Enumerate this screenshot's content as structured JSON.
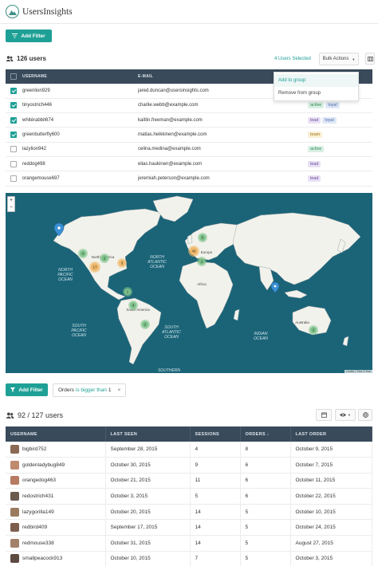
{
  "app": {
    "brand": "UsersInsights"
  },
  "toolbar1": {
    "add_filter": "Add Filter"
  },
  "users_header": {
    "count": "126 users",
    "selected": "4 Users Selected",
    "bulk_actions": "Bulk Actions"
  },
  "dropdown": {
    "items": [
      "Add to group",
      "Remove from group"
    ]
  },
  "table1": {
    "columns": [
      "USERNAME",
      "E-MAIL"
    ],
    "rows": [
      {
        "checked": true,
        "username": "greenlion929",
        "email": "jared.duncan@usersinsights.com",
        "tags": []
      },
      {
        "checked": true,
        "username": "tinyostrich446",
        "email": "charlie.webb@example.com",
        "tags": [
          "active",
          "loyal"
        ]
      },
      {
        "checked": true,
        "username": "whitérabbit674",
        "email": "kaitlin.freeman@example.com",
        "tags": [
          "lead",
          "loyal"
        ]
      },
      {
        "checked": true,
        "username": "greenbutterfly600",
        "email": "matias.heikkinen@example.com",
        "tags": [
          "team"
        ]
      },
      {
        "checked": false,
        "username": "lazylion942",
        "email": "celina.medina@example.com",
        "tags": [
          "active"
        ]
      },
      {
        "checked": false,
        "username": "reddog498",
        "email": "elias.haukinen@example.com",
        "tags": [
          "lead"
        ]
      },
      {
        "checked": false,
        "username": "orangemouse697",
        "email": "jeremiah.peterson@example.com",
        "tags": [
          "lead"
        ]
      }
    ]
  },
  "map": {
    "labels": {
      "north_america": "North America",
      "europe": "Europe",
      "africa": "Africa",
      "south_america": "South America",
      "australia": "Australia",
      "north_pacific": [
        "NORTH",
        "PACIFIC",
        "OCEAN"
      ],
      "north_atlantic": [
        "NORTH",
        "ATLANTIC",
        "OCEAN"
      ],
      "south_pacific": [
        "SOUTH",
        "PACIFIC",
        "OCEAN"
      ],
      "south_atlantic": [
        "SOUTH",
        "ATLANTIC",
        "OCEAN"
      ],
      "indian": [
        "INDIAN",
        "OCEAN"
      ],
      "southern": "SOUTHERN"
    },
    "clusters": [
      "4",
      "2",
      "17",
      "3",
      "6",
      "40",
      "2",
      "2",
      "4",
      "2",
      "2"
    ],
    "zoom_in": "+",
    "zoom_out": "−",
    "credit": "Leaflet | Tiles © Esri"
  },
  "filter2": {
    "add_filter": "Add Filter",
    "chip_field": "Orders",
    "chip_operator": "is bigger than",
    "chip_value": "1",
    "chip_remove": "×"
  },
  "users2": {
    "count": "92 / 127 users"
  },
  "table2": {
    "columns": [
      "USERNAME",
      "LAST SEEN",
      "SESSIONS",
      "ORDERS ↓",
      "LAST ORDER"
    ],
    "rows": [
      {
        "username": "bigbird752",
        "last_seen": "September 28, 2015",
        "sessions": "4",
        "orders": "8",
        "last_order": "October 9, 2015",
        "avatar": "#8a6a55"
      },
      {
        "username": "goldenladybug849",
        "last_seen": "October 30, 2015",
        "sessions": "9",
        "orders": "6",
        "last_order": "October 7, 2015",
        "avatar": "#c08a6e"
      },
      {
        "username": "orangedog463",
        "last_seen": "October 21, 2015",
        "sessions": "11",
        "orders": "6",
        "last_order": "October 11, 2015",
        "avatar": "#b77a63"
      },
      {
        "username": "redostrich431",
        "last_seen": "October 3, 2015",
        "sessions": "5",
        "orders": "6",
        "last_order": "October 22, 2015",
        "avatar": "#6b5a4e"
      },
      {
        "username": "lazygorilla149",
        "last_seen": "October 20, 2015",
        "sessions": "14",
        "orders": "5",
        "last_order": "October 10, 2015",
        "avatar": "#9a7b5d"
      },
      {
        "username": "redbird409",
        "last_seen": "September 17, 2015",
        "sessions": "14",
        "orders": "5",
        "last_order": "October 24, 2015",
        "avatar": "#7d5e4c"
      },
      {
        "username": "redmouse338",
        "last_seen": "October 31, 2015",
        "sessions": "14",
        "orders": "5",
        "last_order": "August 27, 2015",
        "avatar": "#a3806a"
      },
      {
        "username": "smallpeacock913",
        "last_seen": "October 10, 2015",
        "sessions": "7",
        "orders": "5",
        "last_order": "October 3, 2015",
        "avatar": "#5d4a40"
      }
    ]
  },
  "colors": {
    "accent": "#1fa096",
    "header_dark": "#394a5a",
    "ocean": "#1b6478",
    "land": "#f2f2ec",
    "cluster_green": "#7ec28a",
    "cluster_orange": "#f0b86a"
  }
}
